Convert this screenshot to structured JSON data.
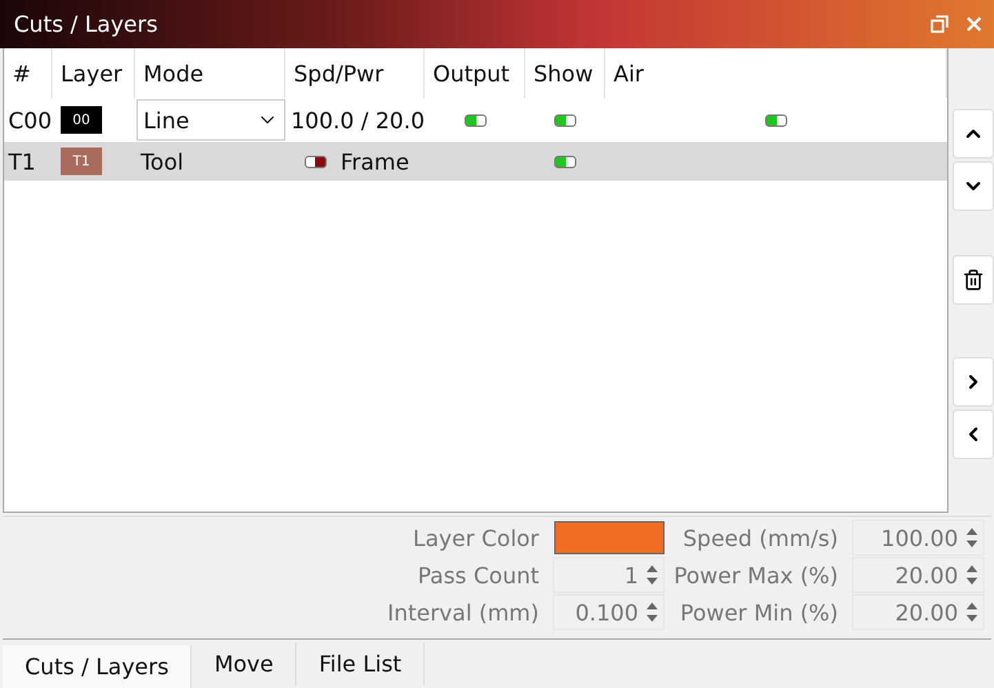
{
  "window": {
    "title": "Cuts / Layers"
  },
  "table": {
    "columns": [
      "#",
      "Layer",
      "Mode",
      "Spd/Pwr",
      "Output",
      "Show",
      "Air"
    ],
    "rows": [
      {
        "number": "C00",
        "layer": {
          "label": "00",
          "color": "#000000"
        },
        "mode": {
          "kind": "dropdown",
          "value": "Line"
        },
        "spd_pwr": "100.0 / 20.0",
        "output": true,
        "show": true,
        "air": true,
        "selected": false
      },
      {
        "number": "T1",
        "layer": {
          "label": "T1",
          "color": "#a86b5c"
        },
        "mode": {
          "kind": "text",
          "value": "Tool"
        },
        "frame": {
          "on": false,
          "label": "Frame"
        },
        "show": true,
        "selected": true
      }
    ]
  },
  "properties": {
    "layer_color": {
      "label": "Layer Color",
      "color": "#f26c23"
    },
    "left": [
      {
        "label": "Pass Count",
        "value": "1"
      },
      {
        "label": "Interval (mm)",
        "value": "0.100"
      }
    ],
    "right": [
      {
        "label": "Speed (mm/s)",
        "value": "100.00"
      },
      {
        "label": "Power Max (%)",
        "value": "20.00"
      },
      {
        "label": "Power Min (%)",
        "value": "20.00"
      }
    ]
  },
  "tabs": [
    {
      "label": "Cuts / Layers",
      "selected": true
    },
    {
      "label": "Move",
      "selected": false
    },
    {
      "label": "File List",
      "selected": false
    }
  ]
}
